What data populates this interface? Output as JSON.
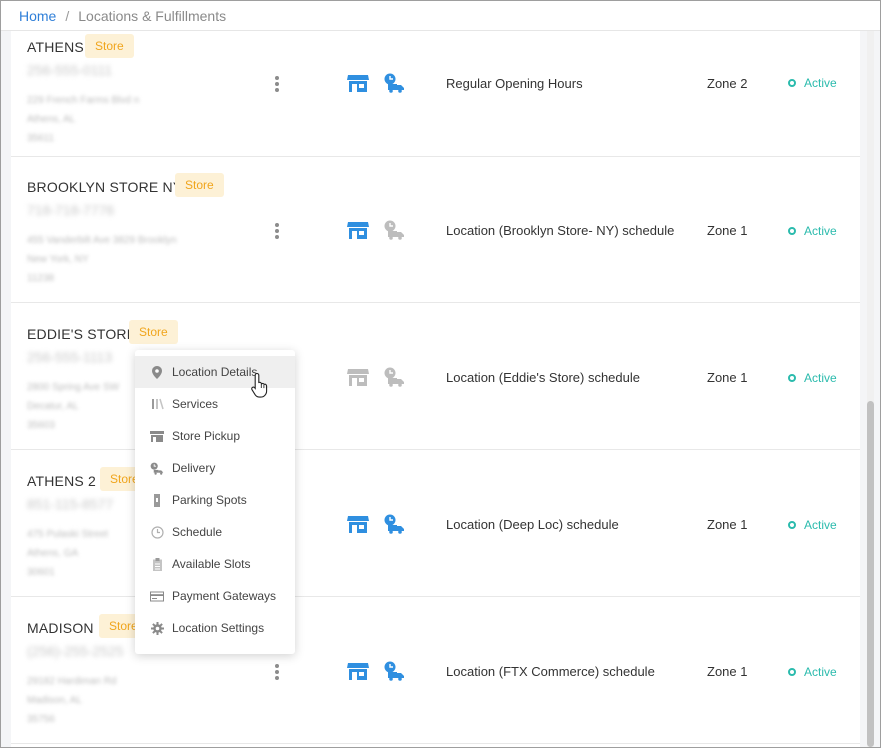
{
  "breadcrumb": {
    "home": "Home",
    "separator": "/",
    "current": "Locations & Fulfillments"
  },
  "locations": [
    {
      "name": "ATHENS",
      "badge": "Store",
      "phone": "256-555-0111",
      "address": [
        "229 French Farms Blvd n",
        "Athens, AL",
        "35611"
      ],
      "store_pickup": true,
      "delivery": true,
      "schedule": "Regular Opening Hours",
      "zone": "Zone 2",
      "status": "Active"
    },
    {
      "name": "BROOKLYN STORE NY",
      "badge": "Store",
      "phone": "718-718-7776",
      "address": [
        "455 Vanderbilt Ave 3829 Brooklyn",
        "New York, NY",
        "11238"
      ],
      "store_pickup": true,
      "delivery": false,
      "schedule": "Location (Brooklyn Store- NY) schedule",
      "zone": "Zone 1",
      "status": "Active"
    },
    {
      "name": "EDDIE'S STORE",
      "badge": "Store",
      "phone": "256-555-1113",
      "address": [
        "2800 Spring Ave SW",
        "Decatur, AL",
        "35603"
      ],
      "store_pickup": false,
      "delivery": false,
      "schedule": "Location (Eddie's Store) schedule",
      "zone": "Zone 1",
      "status": "Active"
    },
    {
      "name": "ATHENS 2",
      "badge": "Store",
      "phone": "851-115-8577",
      "address": [
        "475 Pulaski Street",
        "Athens, GA",
        "30601"
      ],
      "store_pickup": true,
      "delivery": true,
      "schedule": "Location (Deep Loc) schedule",
      "zone": "Zone 1",
      "status": "Active"
    },
    {
      "name": "MADISON",
      "badge": "Store",
      "phone": "(256)-255-2525",
      "address": [
        "29182 Hardiman Rd",
        "Madison, AL",
        "35756"
      ],
      "store_pickup": true,
      "delivery": true,
      "schedule": "Location (FTX Commerce) schedule",
      "zone": "Zone 1",
      "status": "Active"
    }
  ],
  "context_menu": {
    "items": [
      {
        "label": "Location Details",
        "icon": "map-pin-icon"
      },
      {
        "label": "Services",
        "icon": "services-icon"
      },
      {
        "label": "Store Pickup",
        "icon": "store-icon"
      },
      {
        "label": "Delivery",
        "icon": "delivery-icon"
      },
      {
        "label": "Parking Spots",
        "icon": "parking-icon"
      },
      {
        "label": "Schedule",
        "icon": "clock-icon"
      },
      {
        "label": "Available Slots",
        "icon": "clipboard-icon"
      },
      {
        "label": "Payment Gateways",
        "icon": "card-icon"
      },
      {
        "label": "Location Settings",
        "icon": "gear-icon"
      }
    ]
  },
  "colors": {
    "link": "#2f7fd8",
    "badge_bg": "#fdf1d6",
    "badge_text": "#f0a51c",
    "icon_active": "#2f8fe0",
    "icon_inactive": "#bdbdbd",
    "status": "#2bbbad"
  }
}
